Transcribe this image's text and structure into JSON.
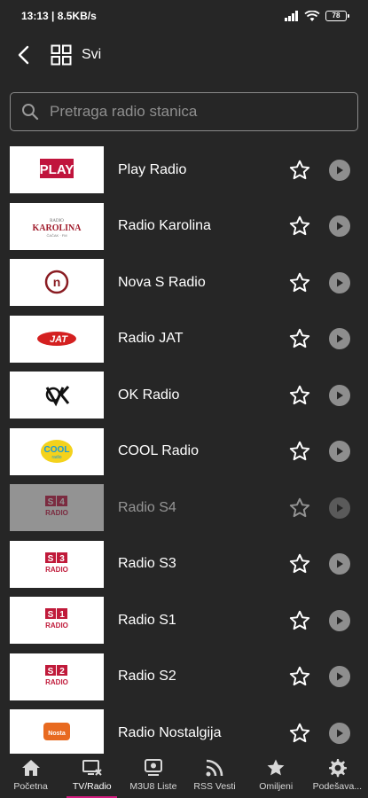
{
  "status": {
    "time": "13:13",
    "speed": "8.5KB/s",
    "battery": "78"
  },
  "header": {
    "title": "Svi"
  },
  "search": {
    "placeholder": "Pretraga radio stanica"
  },
  "stations": [
    {
      "name": "Play Radio",
      "logo": "PLAY",
      "logo_color": "#c0143c",
      "dim": false
    },
    {
      "name": "Radio Karolina",
      "logo": "KAROLINA",
      "logo_color": "#a01c2c",
      "dim": false
    },
    {
      "name": "Nova S Radio",
      "logo": "@",
      "logo_color": "#8a1c22",
      "dim": false
    },
    {
      "name": "Radio JAT",
      "logo": "JAT",
      "logo_color": "#d42020",
      "dim": false
    },
    {
      "name": "OK Radio",
      "logo": "OK",
      "logo_color": "#111111",
      "dim": false
    },
    {
      "name": "COOL Radio",
      "logo": "COOL",
      "logo_color": "#1a9ad8",
      "dim": false
    },
    {
      "name": "Radio S4",
      "logo": "S4",
      "logo_color": "#d0305a",
      "dim": true
    },
    {
      "name": "Radio S3",
      "logo": "S3",
      "logo_color": "#c01a3a",
      "dim": false
    },
    {
      "name": "Radio S1",
      "logo": "S1",
      "logo_color": "#c01a3a",
      "dim": false
    },
    {
      "name": "Radio S2",
      "logo": "S2",
      "logo_color": "#c01a3a",
      "dim": false
    },
    {
      "name": "Radio Nostalgija",
      "logo": "Nostalgija",
      "logo_color": "#e86a20",
      "dim": false
    }
  ],
  "nav": [
    {
      "label": "Početna",
      "icon": "home-icon",
      "active": false
    },
    {
      "label": "TV/Radio",
      "icon": "tv-icon",
      "active": true
    },
    {
      "label": "M3U8 Liste",
      "icon": "playlist-icon",
      "active": false
    },
    {
      "label": "RSS Vesti",
      "icon": "rss-icon",
      "active": false
    },
    {
      "label": "Omiljeni",
      "icon": "star-icon",
      "active": false
    },
    {
      "label": "Podešava...",
      "icon": "gear-icon",
      "active": false
    }
  ],
  "colors": {
    "background": "#262626",
    "accent": "#d21c7e",
    "play_button": "#8e8e8e"
  }
}
